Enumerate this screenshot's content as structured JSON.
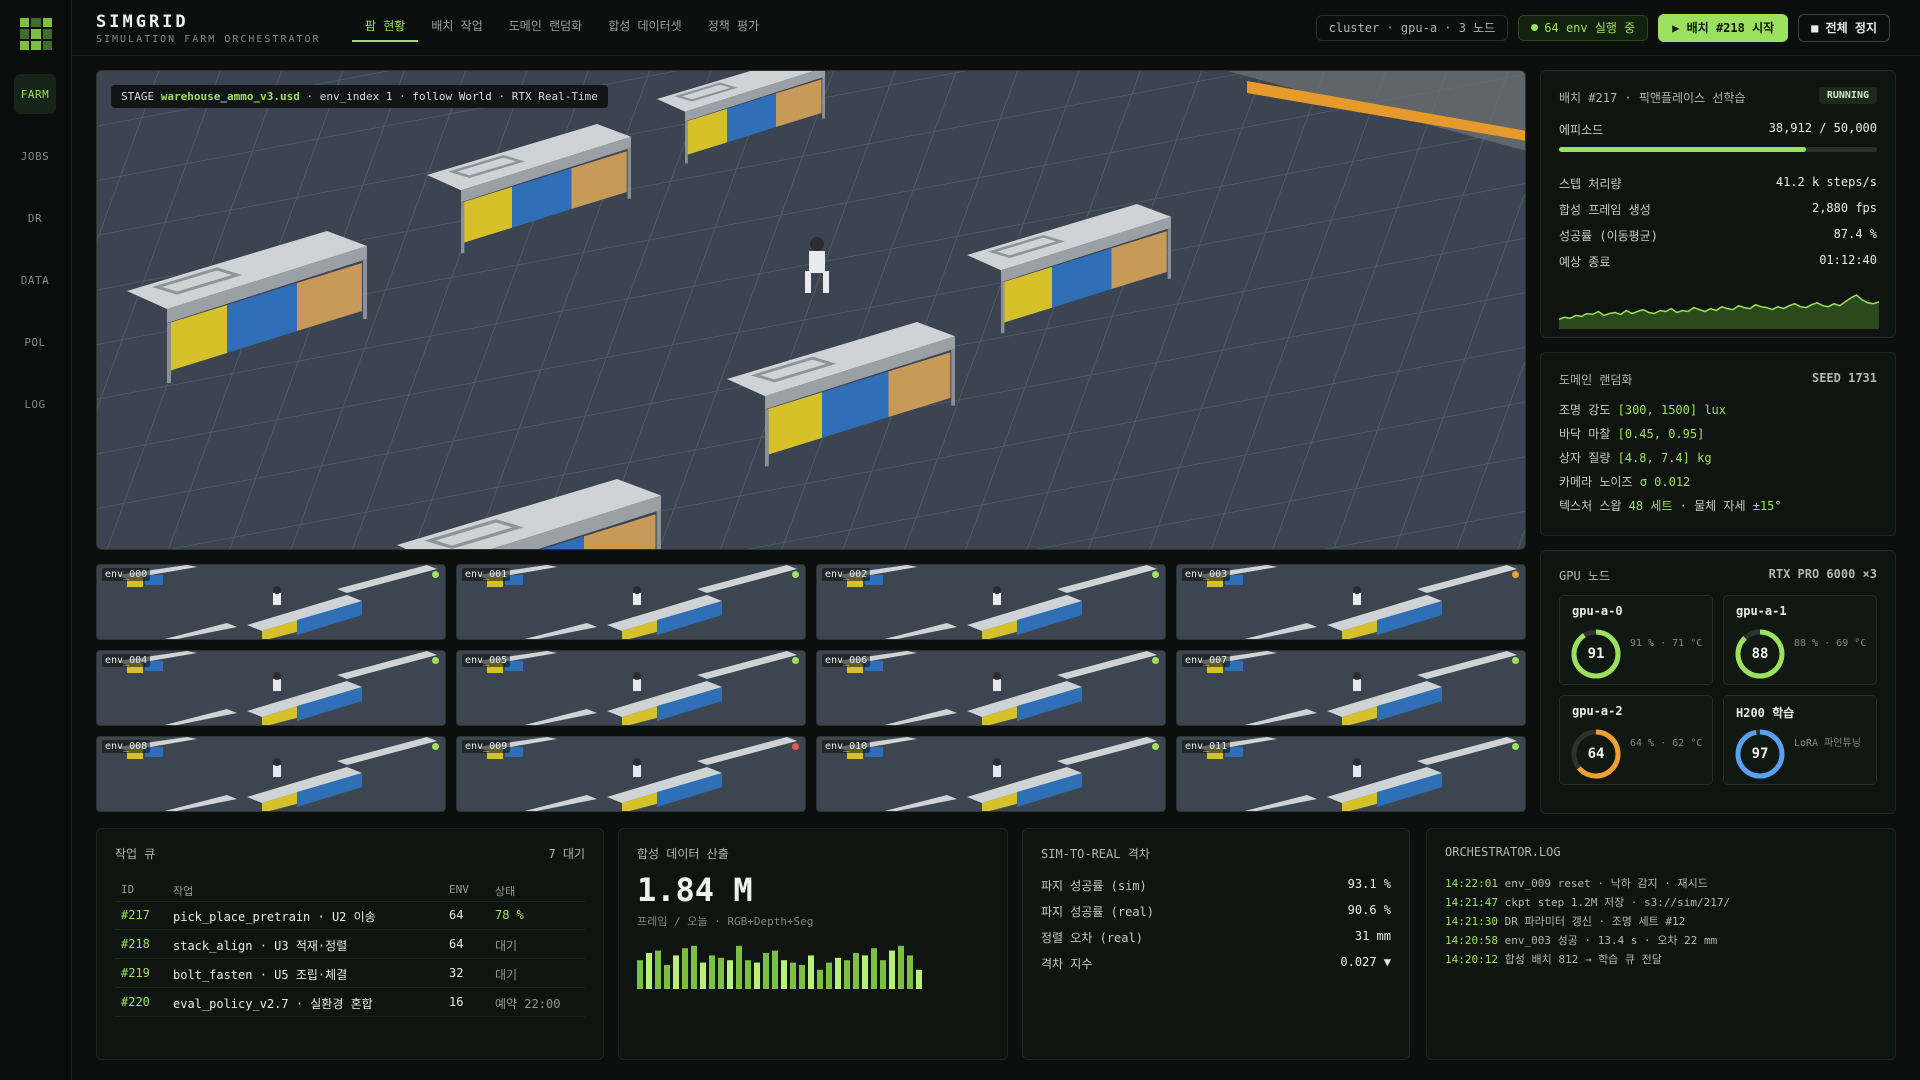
{
  "brand": {
    "title": "SIMGRID",
    "subtitle": "SIMULATION FARM ORCHESTRATOR"
  },
  "rail": [
    "FARM",
    "JOBS",
    "DR",
    "DATA",
    "POL",
    "LOG"
  ],
  "tabs": [
    "팜 현황",
    "배치 작업",
    "도메인 랜덤화",
    "합성 데이터셋",
    "정책 평가"
  ],
  "header": {
    "cluster": "cluster · gpu-a · 3 노드",
    "running": "64 env 실행 중",
    "start": "▶ 배치 #218 시작",
    "stop": "■ 전체 정지"
  },
  "stage": {
    "prefix": "STAGE",
    "file": "warehouse_ammo_v3.usd",
    "rest": " · env_index 1 · follow World · RTX Real-Time"
  },
  "envs": [
    {
      "name": "env_000",
      "status": "#9be15d"
    },
    {
      "name": "env_001",
      "status": "#9be15d"
    },
    {
      "name": "env_002",
      "status": "#9be15d"
    },
    {
      "name": "env_003",
      "status": "#f0a030"
    },
    {
      "name": "env_004",
      "status": "#9be15d"
    },
    {
      "name": "env_005",
      "status": "#9be15d"
    },
    {
      "name": "env_006",
      "status": "#9be15d"
    },
    {
      "name": "env_007",
      "status": "#9be15d"
    },
    {
      "name": "env_008",
      "status": "#9be15d"
    },
    {
      "name": "env_009",
      "status": "#e05a5a"
    },
    {
      "name": "env_010",
      "status": "#9be15d"
    },
    {
      "name": "env_011",
      "status": "#9be15d"
    }
  ],
  "batch": {
    "title": "배치 #217 · 픽앤플레이스 선학습",
    "state": "RUNNING",
    "episodes_label": "에피소드",
    "episodes_value": "38,912 / 50,000",
    "progress": 0.778,
    "metrics": [
      {
        "k": "스텝 처리량",
        "v": "41.2 k steps/s",
        "accent": true
      },
      {
        "k": "합성 프레임 생성",
        "v": "2,880 fps",
        "accent": false
      },
      {
        "k": "성공률 (이동평균)",
        "v": "87.4 %",
        "accent": false
      },
      {
        "k": "예상 종료",
        "v": "01:12:40",
        "accent": false
      }
    ],
    "sparkline": [
      30,
      32,
      31,
      34,
      33,
      36,
      35,
      38,
      34,
      36,
      37,
      35,
      39,
      36,
      38,
      40,
      37,
      36,
      39,
      38,
      41,
      37,
      39,
      38,
      42,
      40,
      38,
      41,
      39,
      43,
      41,
      40,
      44,
      42,
      41,
      45,
      43,
      42,
      40,
      43,
      41,
      44,
      46,
      43,
      42,
      45,
      47,
      44,
      43,
      46,
      44,
      48,
      52,
      55,
      50,
      47,
      46,
      48
    ]
  },
  "dr": {
    "title": "도메인 랜덤화",
    "seed": "SEED 1731",
    "lines": [
      [
        {
          "t": "조명 강도 "
        },
        {
          "t": "[300, 1500] lux",
          "a": true
        }
      ],
      [
        {
          "t": "바닥 마찰 "
        },
        {
          "t": "[0.45, 0.95]",
          "a": true
        }
      ],
      [
        {
          "t": "상자 질량 "
        },
        {
          "t": "[4.8, 7.4] kg",
          "a": true
        }
      ],
      [
        {
          "t": "카메라 노이즈 "
        },
        {
          "t": "σ 0.012",
          "a": true
        }
      ],
      [
        {
          "t": "텍스처 스왑 "
        },
        {
          "t": "48 세트",
          "a": true
        },
        {
          "t": " · 물체 자세 "
        },
        {
          "t": "±15°",
          "a": true
        }
      ]
    ]
  },
  "gpu": {
    "title": "GPU 노드",
    "model": "RTX PRO 6000 ×3",
    "nodes": [
      {
        "name": "gpu-a-0",
        "value": "91",
        "pct": 0.91,
        "meta": "91 % · 71 °C",
        "color": "#9be15d"
      },
      {
        "name": "gpu-a-1",
        "value": "88",
        "pct": 0.88,
        "meta": "88 % · 69 °C",
        "color": "#9be15d"
      },
      {
        "name": "gpu-a-2",
        "value": "64",
        "pct": 0.64,
        "meta": "64 % · 62 °C",
        "color": "#f0a030"
      },
      {
        "name": "H200 학습",
        "value": "97",
        "pct": 0.97,
        "meta": "LoRA 파인튜닝",
        "color": "#5aa0f0"
      }
    ]
  },
  "queue": {
    "title": "작업 큐",
    "count": "7 대기",
    "headers": {
      "id": "ID",
      "job": "작업",
      "env": "ENV",
      "status": "상태"
    },
    "rows": [
      {
        "id": "#217",
        "job": "pick_place_pretrain · U2 이송",
        "env": "64",
        "status": "78 %",
        "accent": true
      },
      {
        "id": "#218",
        "job": "stack_align · U3 적재·정렬",
        "env": "64",
        "status": "대기",
        "accent": false
      },
      {
        "id": "#219",
        "job": "bolt_fasten · U5 조립·체결",
        "env": "32",
        "status": "대기",
        "accent": false
      },
      {
        "id": "#220",
        "job": "eval_policy_v2.7 · 실환경 혼합",
        "env": "16",
        "status": "예약 22:00",
        "accent": false
      }
    ]
  },
  "synth": {
    "title": "합성 데이터 산출",
    "big": "1.84 M",
    "sub": "프레임 / 오늘 · RGB+Depth+Seg",
    "bars": [
      0.6,
      0.75,
      0.8,
      0.5,
      0.7,
      0.85,
      0.9,
      0.55,
      0.7,
      0.65,
      0.6,
      0.9,
      0.6,
      0.55,
      0.75,
      0.8,
      0.6,
      0.55,
      0.5,
      0.7,
      0.4,
      0.55,
      0.65,
      0.6,
      0.75,
      0.7,
      0.85,
      0.6,
      0.8,
      0.9,
      0.7,
      0.4
    ]
  },
  "gap": {
    "title": "SIM-TO-REAL 격차",
    "rows": [
      {
        "k": "파지 성공률 (sim)",
        "v": "93.1 %",
        "accent": false
      },
      {
        "k": "파지 성공률 (real)",
        "v": "90.6 %",
        "accent": false
      },
      {
        "k": "정렬 오차 (real)",
        "v": "31 mm",
        "accent": false
      },
      {
        "k": "격차 지수",
        "v": "0.027 ▼",
        "accent": true
      }
    ]
  },
  "log": {
    "title": "ORCHESTRATOR.LOG",
    "lines": [
      {
        "t": "14:22:01",
        "m": "env_009 reset · 낙하 감지 · 재시드"
      },
      {
        "t": "14:21:47",
        "m": "ckpt step 1.2M 저장 · s3://sim/217/"
      },
      {
        "t": "14:21:30",
        "m": "DR 파라미터 갱신 · 조명 세트 #12"
      },
      {
        "t": "14:20:58",
        "m": "env_003 성공 · 13.4 s · 오차 22 mm"
      },
      {
        "t": "14:20:12",
        "m": "합성 배치 812 → 학습 큐 전달"
      }
    ]
  }
}
